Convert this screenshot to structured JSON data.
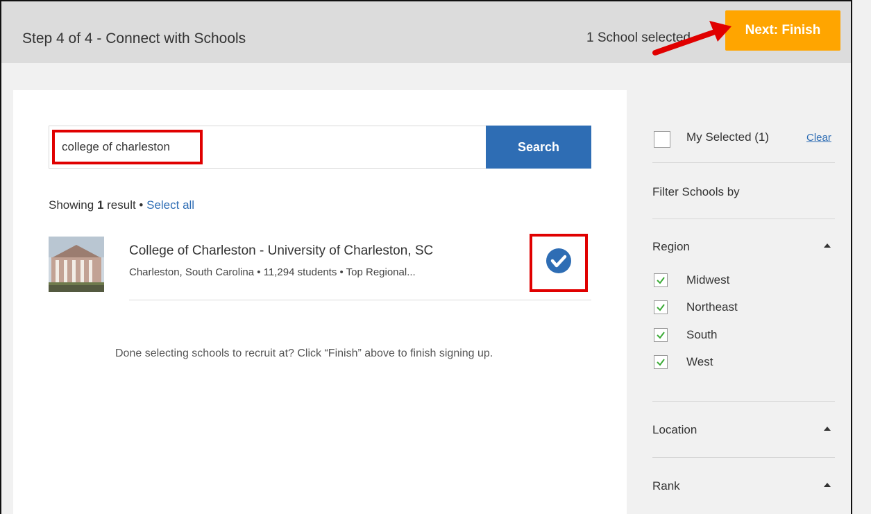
{
  "header": {
    "step_title": "Step 4 of 4 - Connect with Schools",
    "selected_count": "1 School selected",
    "next_button": "Next: Finish"
  },
  "search": {
    "value": "college of charleston",
    "button_label": "Search"
  },
  "results": {
    "showing_prefix": "Showing ",
    "count": "1",
    "result_word": " result",
    "separator": " • ",
    "select_all": "Select all",
    "items": [
      {
        "name": "College of Charleston - University of Charleston, SC",
        "meta": "Charleston, South Carolina • 11,294 students • Top Regional...",
        "selected": true
      }
    ]
  },
  "done_message": "Done selecting schools to recruit at? Click “Finish” above to finish signing up.",
  "sidebar": {
    "my_selected": "My Selected (1)",
    "clear": "Clear",
    "filter_heading": "Filter Schools by",
    "region": {
      "title": "Region",
      "options": [
        {
          "label": "Midwest",
          "checked": true
        },
        {
          "label": "Northeast",
          "checked": true
        },
        {
          "label": "South",
          "checked": true
        },
        {
          "label": "West",
          "checked": true
        }
      ]
    },
    "location": {
      "title": "Location"
    },
    "rank": {
      "title": "Rank"
    }
  },
  "colors": {
    "accent_orange": "#ffa500",
    "primary_blue": "#2e6db4",
    "highlight_red": "#e00000",
    "check_green": "#3aaa35"
  }
}
